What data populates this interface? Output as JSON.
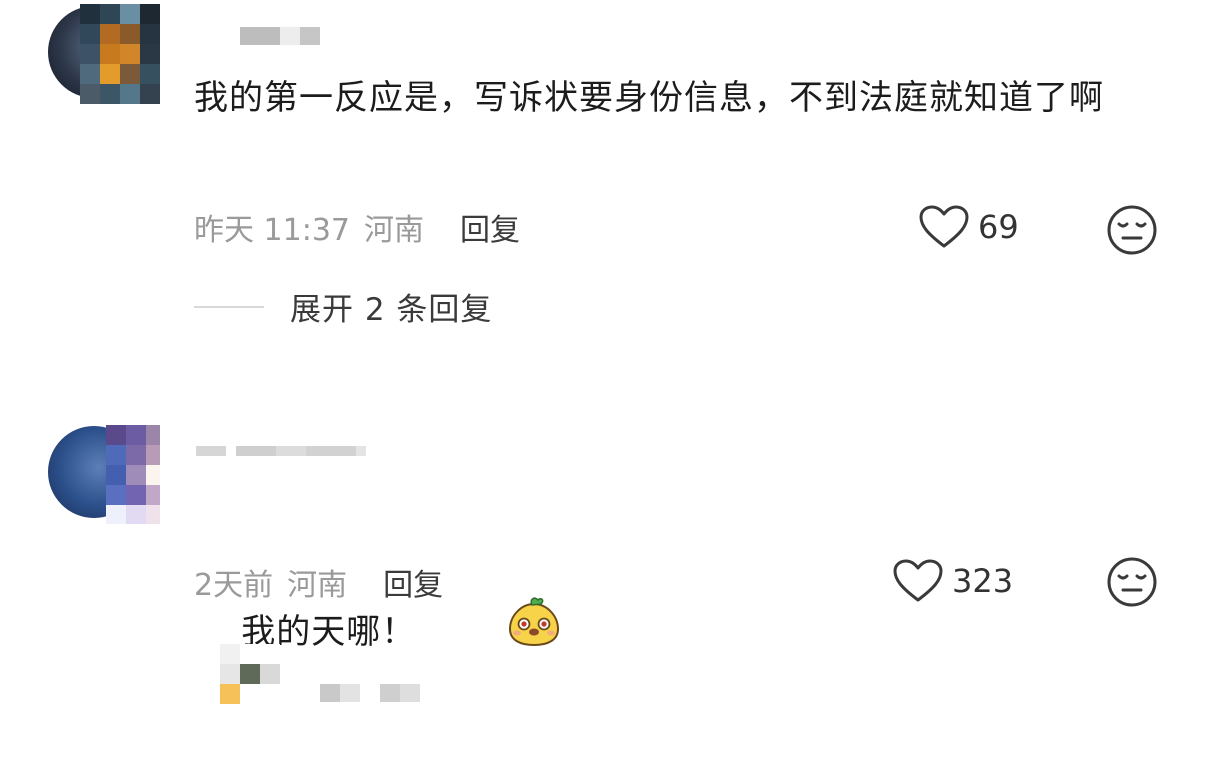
{
  "comments": [
    {
      "content": "我的第一反应是，写诉状要身份信息，不到法庭就知道了啊",
      "time": "昨天 11:37",
      "location": "河南",
      "reply_label": "回复",
      "likes": "69",
      "expand_label": "展开 2 条回复"
    },
    {
      "content": "我的天哪！",
      "time": "2天前",
      "location": "河南",
      "reply_label": "回复",
      "likes": "323"
    }
  ],
  "icons": {
    "like": "heart-outline-icon",
    "dislike": "neutral-face-icon",
    "sticker": "smiling-bun-sticker-icon"
  },
  "colors": {
    "text": "#1c1c1c",
    "meta": "#9a9a9a",
    "reply": "#3b3b3b"
  }
}
